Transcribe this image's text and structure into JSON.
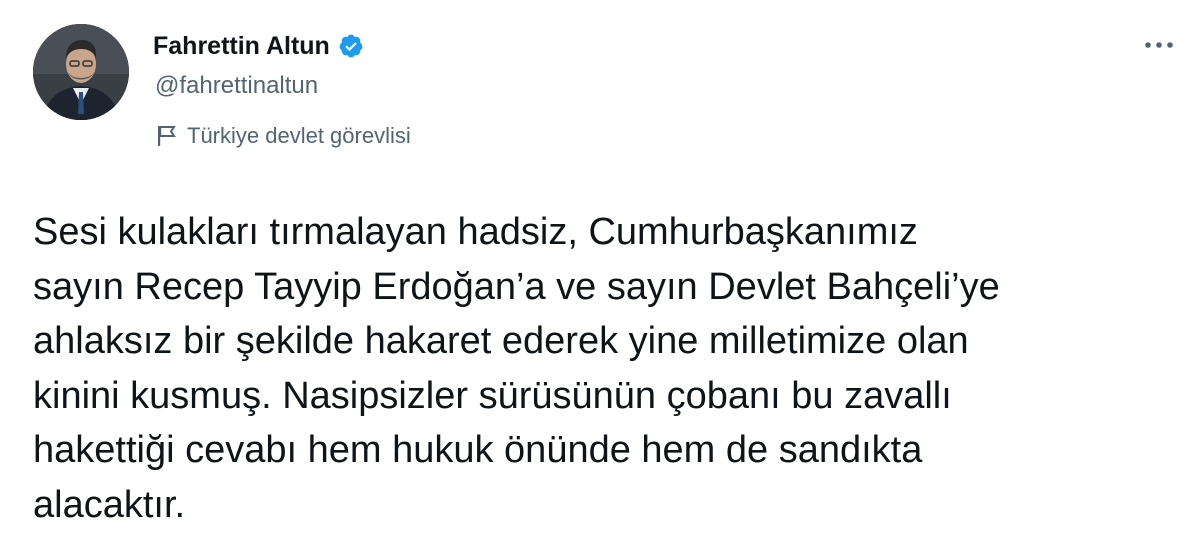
{
  "author": {
    "display_name": "Fahrettin Altun",
    "handle": "@fahrettinaltun",
    "label": "Türkiye devlet görevlisi",
    "avatar_icon": "profile-photo",
    "verified_icon": "verified-badge-icon",
    "label_icon": "flag-icon"
  },
  "menu": {
    "icon": "more-options-icon"
  },
  "tweet": {
    "text": "Sesi kulakları tırmalayan hadsiz, Cumhurbaşkanımız\nsayın Recep Tayyip Erdoğan’a ve sayın Devlet Bahçeli’ye\nahlaksız bir şekilde hakaret ederek yine milletimize olan\nkinini kusmuş. Nasipsizler sürüsünün çobanı bu zavallı\nhakettiği cevabı hem hukuk önünde hem de sandıkta\nalacaktır."
  },
  "colors": {
    "text": "#0f1419",
    "secondary": "#536471",
    "verified": "#1d9bf0",
    "background": "#ffffff"
  }
}
